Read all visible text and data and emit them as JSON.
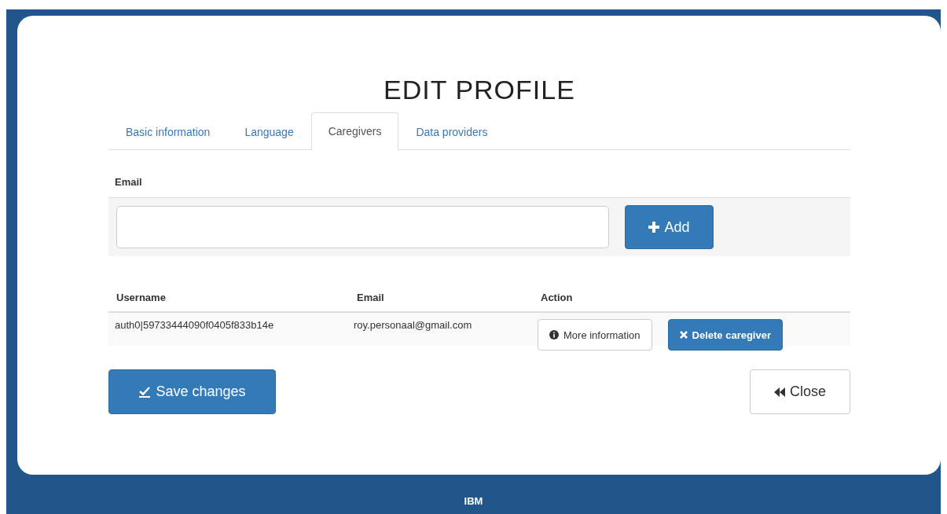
{
  "title": "EDIT PROFILE",
  "tabs": [
    {
      "label": "Basic information",
      "selected": false
    },
    {
      "label": "Language",
      "selected": false
    },
    {
      "label": "Caregivers",
      "selected": true
    },
    {
      "label": "Data providers",
      "selected": false
    }
  ],
  "form": {
    "label": "Email",
    "add_button": "Add"
  },
  "table": {
    "columns": [
      "Username",
      "Email",
      "Action"
    ],
    "rows": [
      {
        "username": "auth0|59733444090f0405f833b14e",
        "email": "roy.personaal@gmail.com",
        "info_button": "More information",
        "delete_button": "Delete caregiver"
      }
    ]
  },
  "save_button": "Save changes",
  "close_button": "Close",
  "footer": "IBM"
}
